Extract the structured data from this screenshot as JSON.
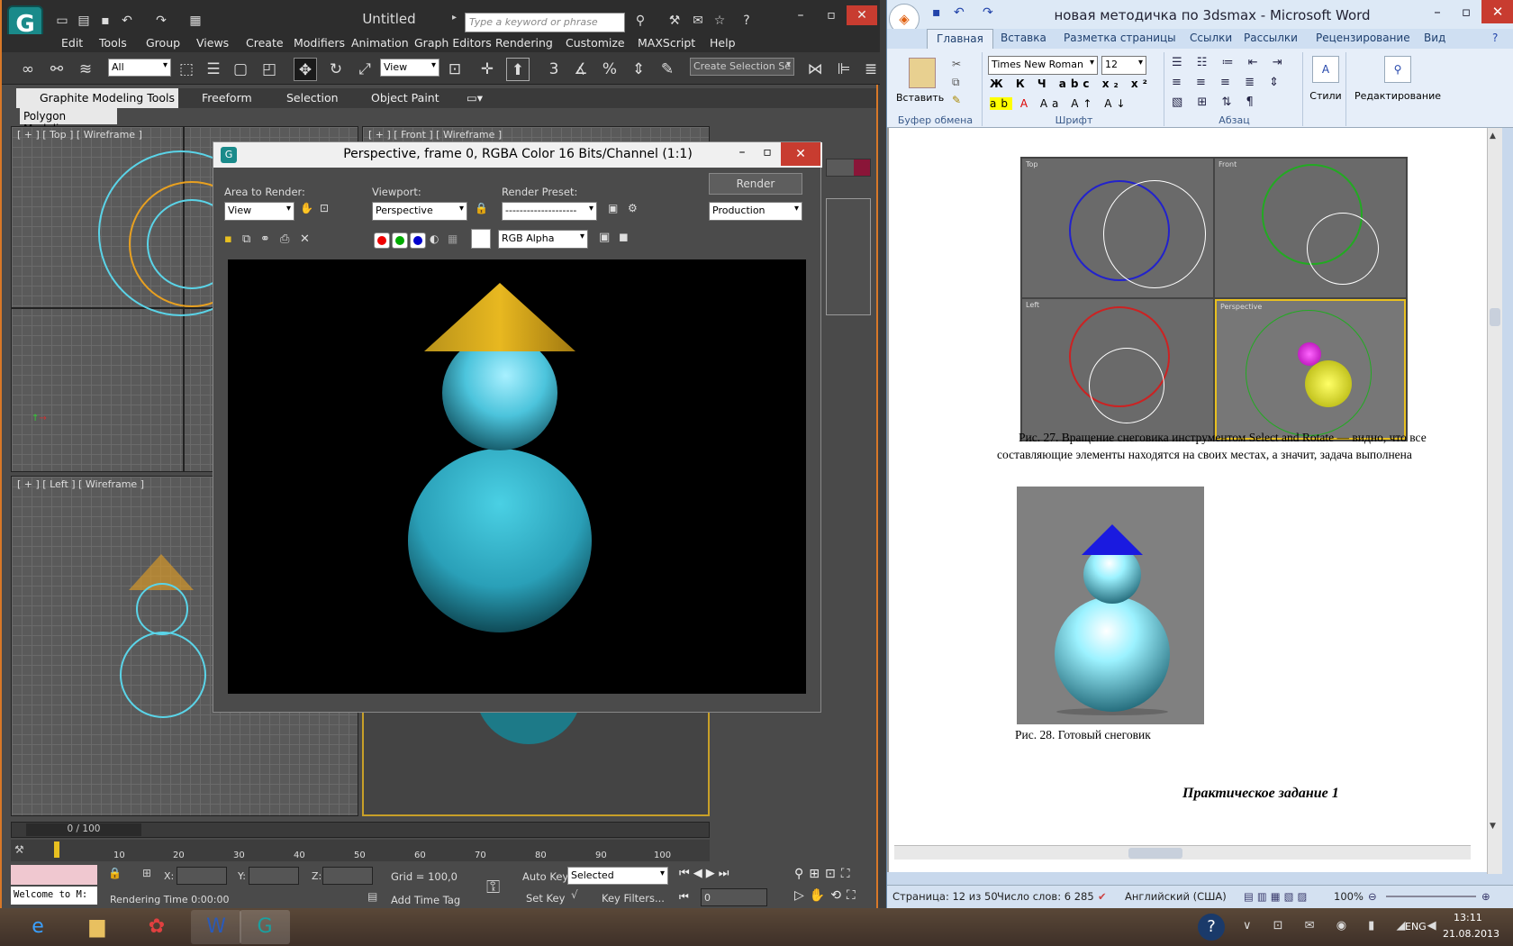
{
  "max": {
    "title": "Untitled",
    "search_placeholder": "Type a keyword or phrase",
    "menu": [
      "Edit",
      "Tools",
      "Group",
      "Views",
      "Create",
      "Modifiers",
      "Animation",
      "Graph Editors",
      "Rendering",
      "Customize",
      "MAXScript",
      "Help"
    ],
    "selection_filter": "All",
    "ref_coord": "View",
    "named_sel": "Create Selection Se",
    "ribbon_tabs": [
      "Graphite Modeling Tools",
      "Freeform",
      "Selection",
      "Object Paint"
    ],
    "ribbon_panel": "Polygon Modeling",
    "viewports": {
      "top": "[ + ] [ Top ] [ Wireframe ]",
      "front": "[ + ] [ Front ] [ Wireframe ]",
      "left": "[ + ] [ Left ] [ Wireframe ]"
    },
    "timeline": {
      "frame": "0 / 100",
      "ticks": [
        "10",
        "20",
        "30",
        "40",
        "50",
        "60",
        "70",
        "80",
        "90",
        "100"
      ]
    },
    "status": {
      "welcome": "Welcome to M:",
      "x_label": "X:",
      "y_label": "Y:",
      "z_label": "Z:",
      "grid": "Grid = 100,0",
      "auto_key": "Auto Key",
      "set_key": "Set Key",
      "selected": "Selected",
      "key_filters": "Key Filters...",
      "frame_value": "0",
      "render_time": "Rendering Time  0:00:00",
      "add_time_tag": "Add Time Tag"
    }
  },
  "render": {
    "title": "Perspective, frame 0, RGBA Color 16 Bits/Channel (1:1)",
    "area_label": "Area to Render:",
    "area_value": "View",
    "viewport_label": "Viewport:",
    "viewport_value": "Perspective",
    "preset_label": "Render Preset:",
    "preset_value": "--------------------",
    "render_button": "Render",
    "production_value": "Production",
    "channel_value": "RGB Alpha"
  },
  "word": {
    "title": "новая методичка по 3dsmax - Microsoft Word",
    "tabs": [
      "Главная",
      "Вставка",
      "Разметка страницы",
      "Ссылки",
      "Рассылки",
      "Рецензирование",
      "Вид"
    ],
    "font_name": "Times New Roman",
    "font_size": "12",
    "groups": {
      "clipboard": "Буфер обмена",
      "font": "Шрифт",
      "paragraph": "Абзац",
      "styles": "Стили",
      "editing": "Редактирование",
      "paste": "Вставить"
    },
    "caption27_line1": "Рис. 27. Вращение снеговика инструментом Select and Rotate — видно, что все",
    "caption27_line2": "составляющие элементы находятся на своих местах, а значит, задача выполнена",
    "caption28": "Рис. 28. Готовый снеговик",
    "heading": "Практическое задание 1",
    "fig_labels": {
      "top": "Top",
      "front": "Front",
      "left": "Left",
      "perspective": "Perspective"
    },
    "status": {
      "page": "Страница: 12 из 50",
      "words": "Число слов: 6 285",
      "lang": "Английский (США)",
      "zoom": "100%"
    }
  },
  "taskbar": {
    "lang": "ENG",
    "time": "13:11",
    "date": "21.08.2013"
  }
}
